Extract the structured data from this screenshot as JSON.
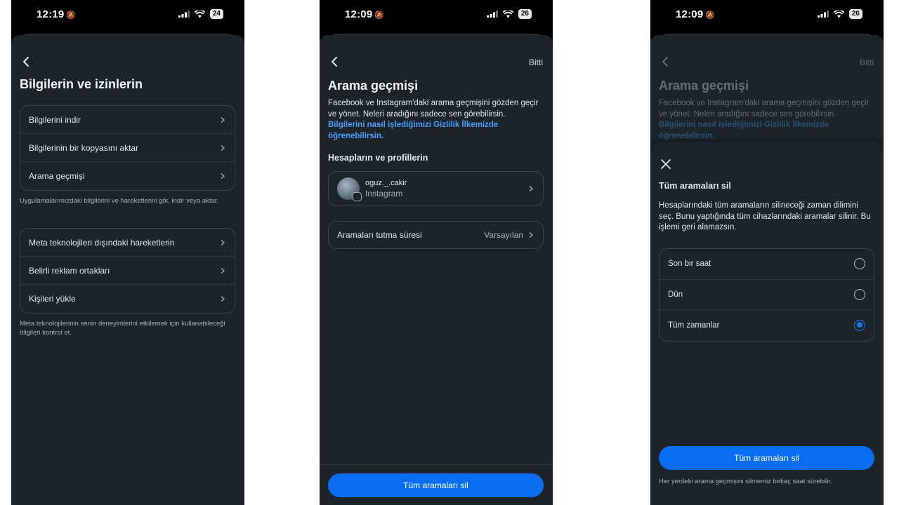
{
  "phone1": {
    "status": {
      "time": "12:19",
      "battery": "24"
    },
    "title": "Bilgilerin ve izinlerin",
    "group1": [
      "Bilgilerini indir",
      "Bilgilerinin bir kopyasını aktar",
      "Arama geçmişi"
    ],
    "note1": "Uygulamalarımızdaki bilgilerini ve hareketlerini gör, indir veya aktar.",
    "group2": [
      "Meta teknolojileri dışındaki hareketlerin",
      "Belirli reklam ortakları",
      "Kişileri yükle"
    ],
    "note2": "Meta teknolojilerinin senin deneyimlerini etkilemek için kullanabileceği bilgileri kontrol et."
  },
  "phone2": {
    "status": {
      "time": "12:09",
      "battery": "26"
    },
    "done": "Bitti",
    "title": "Arama geçmişi",
    "description": "Facebook ve Instagram'daki arama geçmişini gözden geçir ve yönet. Neleri aradığını sadece sen görebilirsin.",
    "link": "Bilgilerini nasıl işlediğimizi Gizlilik İlkemizde öğrenebilirsin.",
    "section": "Hesapların ve profillerin",
    "account": {
      "name": "oguz._.cakir",
      "platform": "Instagram"
    },
    "retention": {
      "label": "Aramaları tutma süresi",
      "value": "Varsayılan"
    },
    "button": "Tüm aramaları sil"
  },
  "phone3": {
    "status": {
      "time": "12:09",
      "battery": "26"
    },
    "bg": {
      "done": "Bitti",
      "title": "Arama geçmişi",
      "description": "Facebook ve Instagram'daki arama geçmişini gözden geçir ve yönet. Neleri aradığını sadece sen görebilirsin.",
      "link": "Bilgilerini nasıl işlediğimizi Gizlilik İlkemizde öğrenebilirsin."
    },
    "modal": {
      "title": "Tüm aramaları sil",
      "description": "Hesaplarındaki tüm aramaların silineceği zaman dilimini seç. Bunu yaptığında tüm cihazlarındaki aramalar silinir. Bu işlemi geri alamazsın.",
      "options": [
        "Son bir saat",
        "Dün",
        "Tüm zamanlar"
      ],
      "selected": "Tüm zamanlar",
      "button": "Tüm aramaları sil",
      "footnote": "Her yerdeki arama geçmişini silmemiz birkaç saat sürebilir."
    }
  }
}
